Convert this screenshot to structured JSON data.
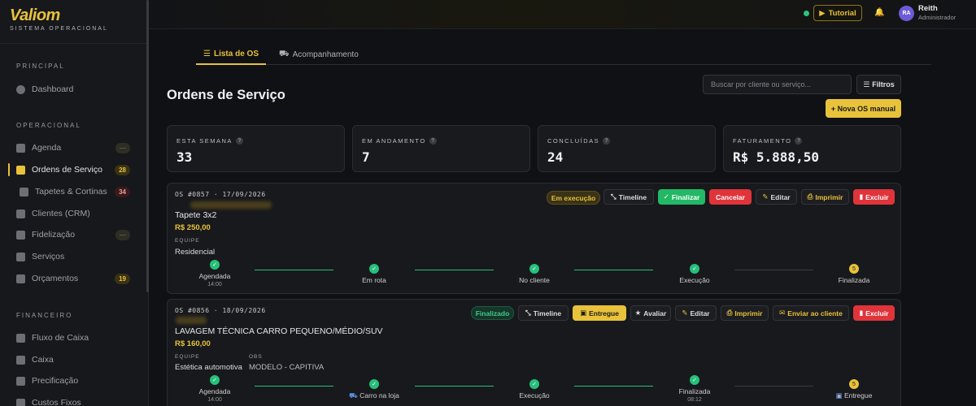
{
  "brand": {
    "name": "Valiom",
    "subtitle": "SISTEMA OPERACIONAL"
  },
  "sidebar": {
    "sections": [
      {
        "title": "PRINCIPAL"
      },
      {
        "title": "OPERACIONAL"
      },
      {
        "title": "FINANCEIRO"
      }
    ],
    "items": [
      {
        "label": "Dashboard",
        "icon": "dashboard-icon"
      },
      {
        "label": "Agenda",
        "icon": "calendar-icon",
        "badge": "—"
      },
      {
        "label": "Ordens de Serviço",
        "icon": "clipboard-icon",
        "badge": "28",
        "active": true
      },
      {
        "label": "Tapetes & Cortinas",
        "icon": "rug-icon",
        "badge": "34"
      },
      {
        "label": "Clientes (CRM)",
        "icon": "contacts-icon"
      },
      {
        "label": "Fidelização",
        "icon": "heart-icon",
        "badge": "—"
      },
      {
        "label": "Serviços",
        "icon": "tools-icon"
      },
      {
        "label": "Orçamentos",
        "icon": "document-icon",
        "badge": "19"
      },
      {
        "label": "Fluxo de Caixa",
        "icon": "cashflow-icon"
      },
      {
        "label": "Caixa",
        "icon": "cash-register-icon"
      },
      {
        "label": "Precificação",
        "icon": "tag-icon"
      },
      {
        "label": "Custos Fixos",
        "icon": "receipt-icon"
      }
    ]
  },
  "topbar": {
    "tutorial_label": "Tutorial",
    "user_initials": "RA",
    "user_name": "Reith",
    "user_role": "Administrador"
  },
  "tabs": [
    {
      "label": "Lista de OS",
      "icon": "list-icon",
      "active": true
    },
    {
      "label": "Acompanhamento",
      "icon": "truck-icon",
      "active": false
    }
  ],
  "page": {
    "title": "Ordens de Serviço",
    "search_placeholder": "Buscar por cliente ou serviço...",
    "filters_label": "Filtros",
    "new_os_label": "+ Nova OS manual"
  },
  "stats": [
    {
      "label": "ESTA SEMANA",
      "value": "33"
    },
    {
      "label": "EM ANDAMENTO",
      "value": "7"
    },
    {
      "label": "CONCLUÍDAS",
      "value": "24"
    },
    {
      "label": "FATURAMENTO",
      "value": "R$ 5.888,50"
    }
  ],
  "orders": [
    {
      "header": "OS #0857 · 17/09/2026",
      "service": "Tapete 3x2",
      "price": "R$ 250,00",
      "team_label": "EQUIPE",
      "team": "Residencial",
      "status": "Em execução",
      "actions": [
        "Timeline",
        "Finalizar",
        "Cancelar",
        "Editar",
        "Imprimir",
        "Excluir"
      ],
      "steps": [
        {
          "label": "Agendada",
          "time": "14:00",
          "done": true
        },
        {
          "label": "Em rota",
          "time": "",
          "done": true
        },
        {
          "label": "No cliente",
          "time": "",
          "done": true
        },
        {
          "label": "Execução",
          "time": "",
          "done": true
        },
        {
          "label": "Finalizada",
          "time": "",
          "done": false
        }
      ]
    },
    {
      "header": "OS #0856 · 18/09/2026",
      "service": "LAVAGEM TÉCNICA CARRO PEQUENO/MÉDIO/SUV",
      "price": "R$ 160,00",
      "team_label": "EQUIPE",
      "team": "Estética automotiva",
      "obs_label": "OBS",
      "obs": "MODELO - CAPITIVA",
      "status": "Finalizado",
      "actions": [
        "Timeline",
        "Entregue",
        "Avaliar",
        "Editar",
        "Imprimir",
        "Enviar ao cliente",
        "Excluir"
      ],
      "steps": [
        {
          "label": "Agendada",
          "time": "14:00",
          "done": true
        },
        {
          "label": "Carro na loja",
          "time": "",
          "done": true
        },
        {
          "label": "Execução",
          "time": "",
          "done": true
        },
        {
          "label": "Finalizada",
          "time": "08:12",
          "done": true
        },
        {
          "label": "Entregue",
          "time": "",
          "done": false
        }
      ]
    }
  ],
  "colors": {
    "accent": "#e8c23a",
    "success": "#27c07a",
    "danger": "#e0343b",
    "background": "#101114"
  }
}
